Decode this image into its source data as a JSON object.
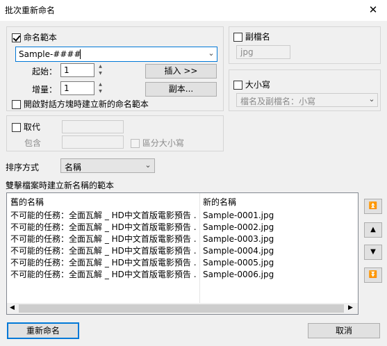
{
  "window": {
    "title": "批次重新命名",
    "close_glyph": "✕"
  },
  "name_template": {
    "label": "命名範本",
    "checked": true,
    "template_value": "Sample-####",
    "start_label": "起始：",
    "start_value": "1",
    "step_label": "增量：",
    "step_value": "1",
    "insert_button": "插入 >>",
    "copy_button": "副本...",
    "new_template_option": "開啟對話方塊時建立新的命名範本"
  },
  "extension": {
    "label": "副檔名",
    "value": "jpg"
  },
  "case": {
    "label": "大小寫",
    "option": "檔名及副檔名：小寫"
  },
  "replace": {
    "label": "取代",
    "contains_label": "包含",
    "case_sensitive": "區分大小寫"
  },
  "sort": {
    "label": "排序方式",
    "value": "名稱"
  },
  "preview": {
    "section_label": "雙擊檔案時建立新名稱的範本",
    "col_old": "舊的名稱",
    "col_new": "新的名稱",
    "rows": [
      {
        "old": "不可能的任務：全面瓦解 _ HD中文首版電影預告 ...",
        "new": "Sample-0001.jpg"
      },
      {
        "old": "不可能的任務：全面瓦解 _ HD中文首版電影預告 ...",
        "new": "Sample-0002.jpg"
      },
      {
        "old": "不可能的任務：全面瓦解 _ HD中文首版電影預告 ...",
        "new": "Sample-0003.jpg"
      },
      {
        "old": "不可能的任務：全面瓦解 _ HD中文首版電影預告 ...",
        "new": "Sample-0004.jpg"
      },
      {
        "old": "不可能的任務：全面瓦解 _ HD中文首版電影預告 ...",
        "new": "Sample-0005.jpg"
      },
      {
        "old": "不可能的任務：全面瓦解 _ HD中文首版電影預告 ...",
        "new": "Sample-0006.jpg"
      }
    ]
  },
  "move_buttons": {
    "top": "⏫",
    "up": "▲",
    "down": "▼",
    "bottom": "⏬"
  },
  "footer": {
    "rename_button": "重新命名",
    "cancel_button": "取消"
  }
}
